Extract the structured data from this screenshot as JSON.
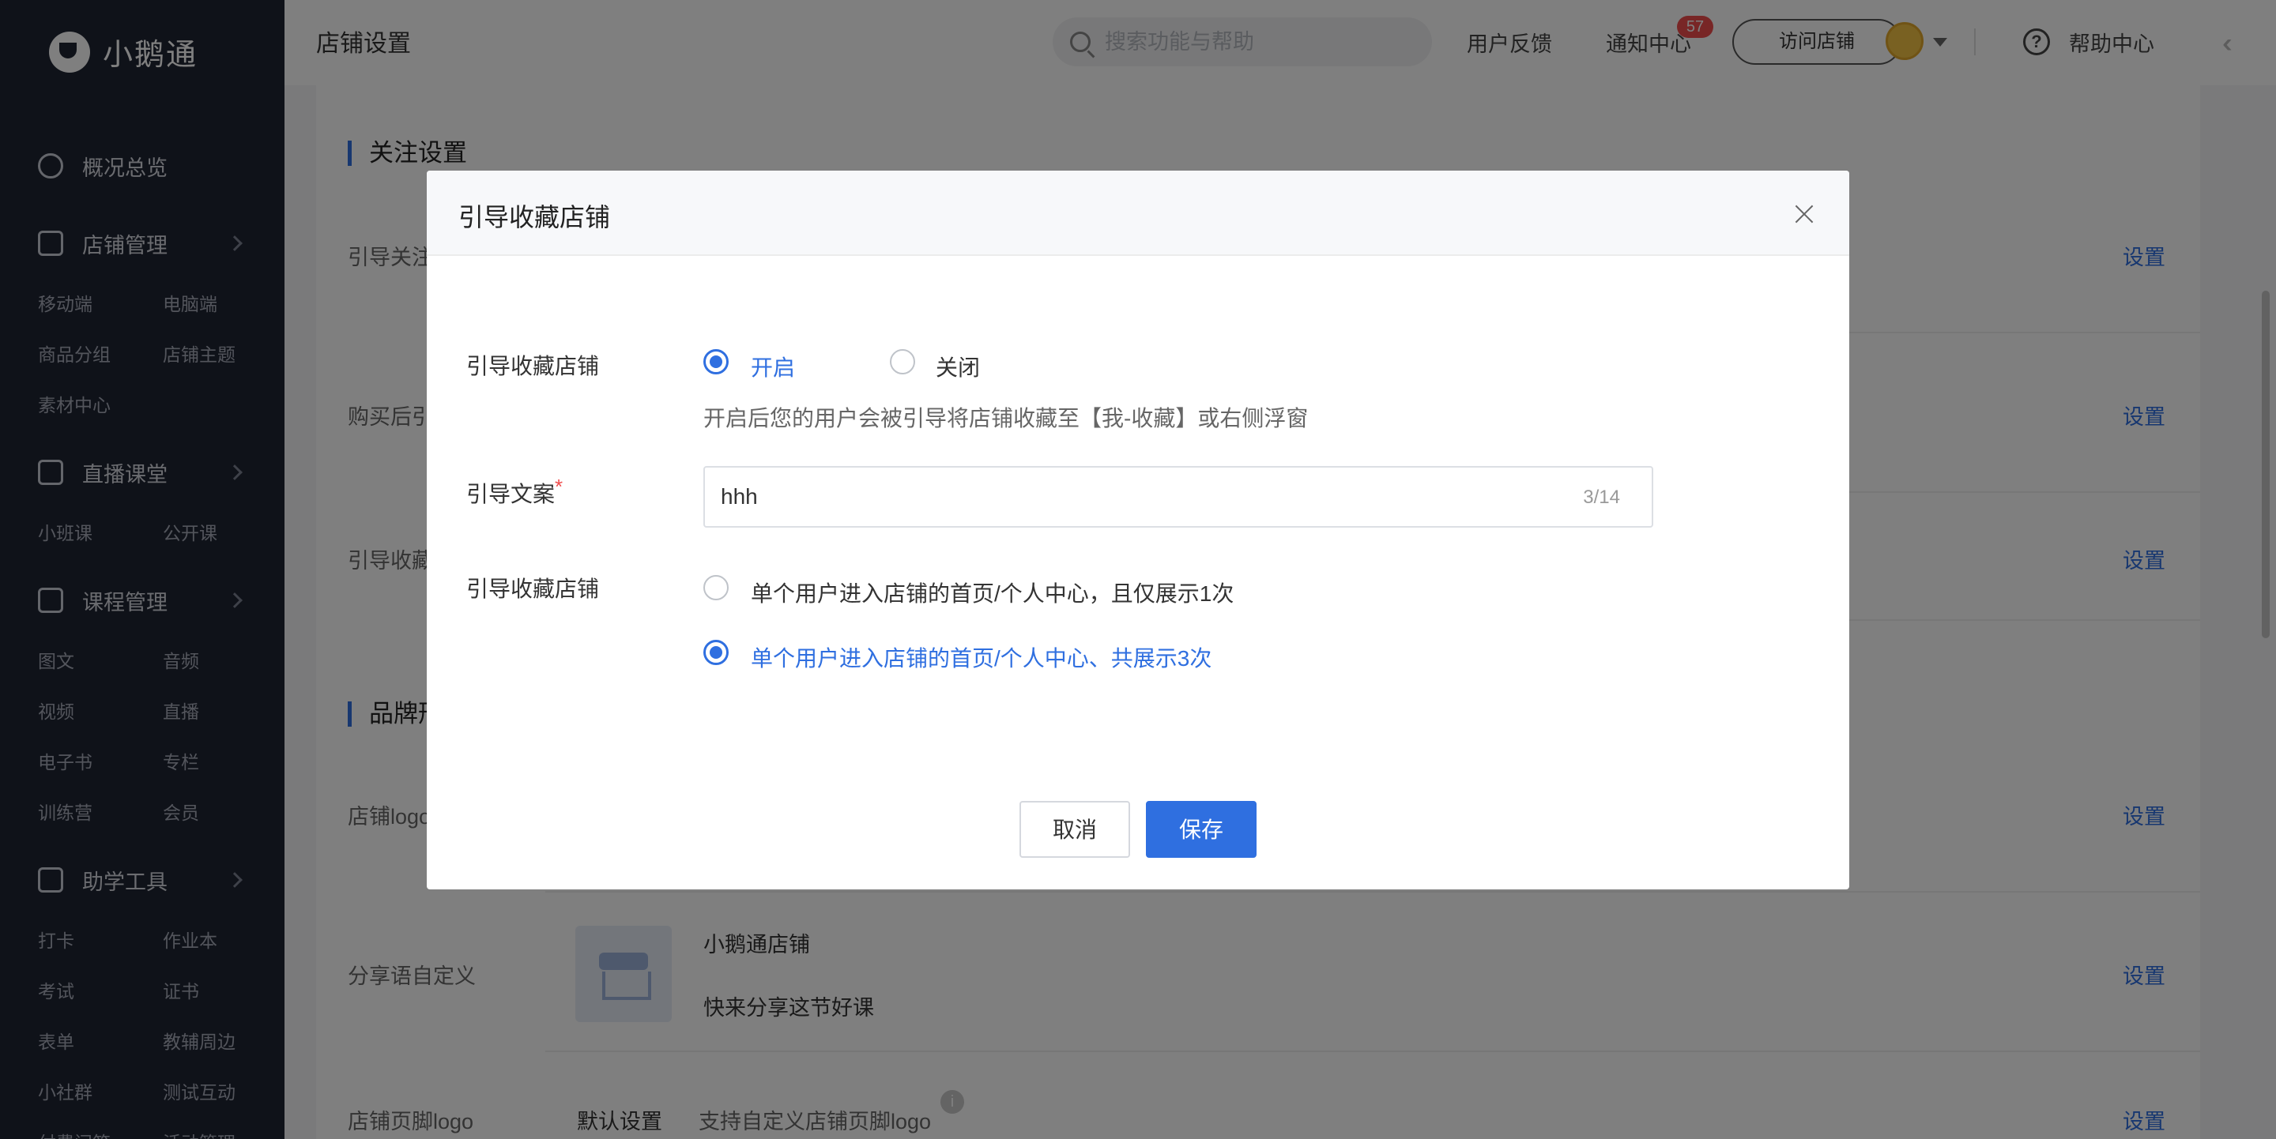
{
  "sidebar": {
    "logo_text": "小鹅通",
    "groups": [
      {
        "label": "概况总览",
        "icon": "pie-chart-icon"
      },
      {
        "label": "店铺管理",
        "icon": "store-icon",
        "subs": [
          "移动端",
          "电脑端",
          "商品分组",
          "店铺主题",
          "素材中心"
        ]
      },
      {
        "label": "直播课堂",
        "icon": "video-camera-icon",
        "subs": [
          "小班课",
          "公开课"
        ]
      },
      {
        "label": "课程管理",
        "icon": "document-icon",
        "subs": [
          "图文",
          "音频",
          "视频",
          "直播",
          "电子书",
          "专栏",
          "训练营",
          "会员"
        ]
      },
      {
        "label": "助学工具",
        "icon": "toolbox-icon",
        "subs": [
          "打卡",
          "作业本",
          "考试",
          "证书",
          "表单",
          "教辅周边",
          "小社群",
          "测试互动",
          "付费问答",
          "活动管理"
        ]
      }
    ]
  },
  "topbar": {
    "title": "店铺设置",
    "search_placeholder": "搜索功能与帮助",
    "feedback": "用户反馈",
    "notice": "通知中心",
    "notice_count": "57",
    "visit_store": "访问店铺",
    "help": "帮助中心"
  },
  "content": {
    "section_follow": "关注设置",
    "section_brand": "品牌形",
    "rows": [
      {
        "label": "引导关注",
        "action": "设置"
      },
      {
        "label": "购买后引",
        "action": "设置"
      },
      {
        "label": "引导收藏",
        "action": "设置"
      },
      {
        "label": "店铺logo",
        "action": "设置"
      },
      {
        "label": "分享语自定义",
        "action": "设置"
      },
      {
        "label": "店铺页脚logo",
        "action": "设置"
      }
    ],
    "store_name": "小鹅通店铺",
    "share_text": "快来分享这节好课",
    "footer_default": "默认设置",
    "footer_desc": "支持自定义店铺页脚logo",
    "info_mark": "i"
  },
  "modal": {
    "title": "引导收藏店铺",
    "field1_label": "引导收藏店铺",
    "opt_on": "开启",
    "opt_off": "关闭",
    "hint": "开启后您的用户会被引导将店铺收藏至【我-收藏】或右侧浮窗",
    "field2_label": "引导文案",
    "required_mark": "*",
    "text_value": "hhh",
    "text_counter": "3/14",
    "field3_label": "引导收藏店铺",
    "freq_once": "单个用户进入店铺的首页/个人中心，且仅展示1次",
    "freq_three": "单个用户进入店铺的首页/个人中心、共展示3次",
    "cancel": "取消",
    "save": "保存"
  },
  "colors": {
    "sidebar_bg": "#1f2433",
    "accent": "#2f6fe0",
    "badge": "#f04d4d"
  }
}
